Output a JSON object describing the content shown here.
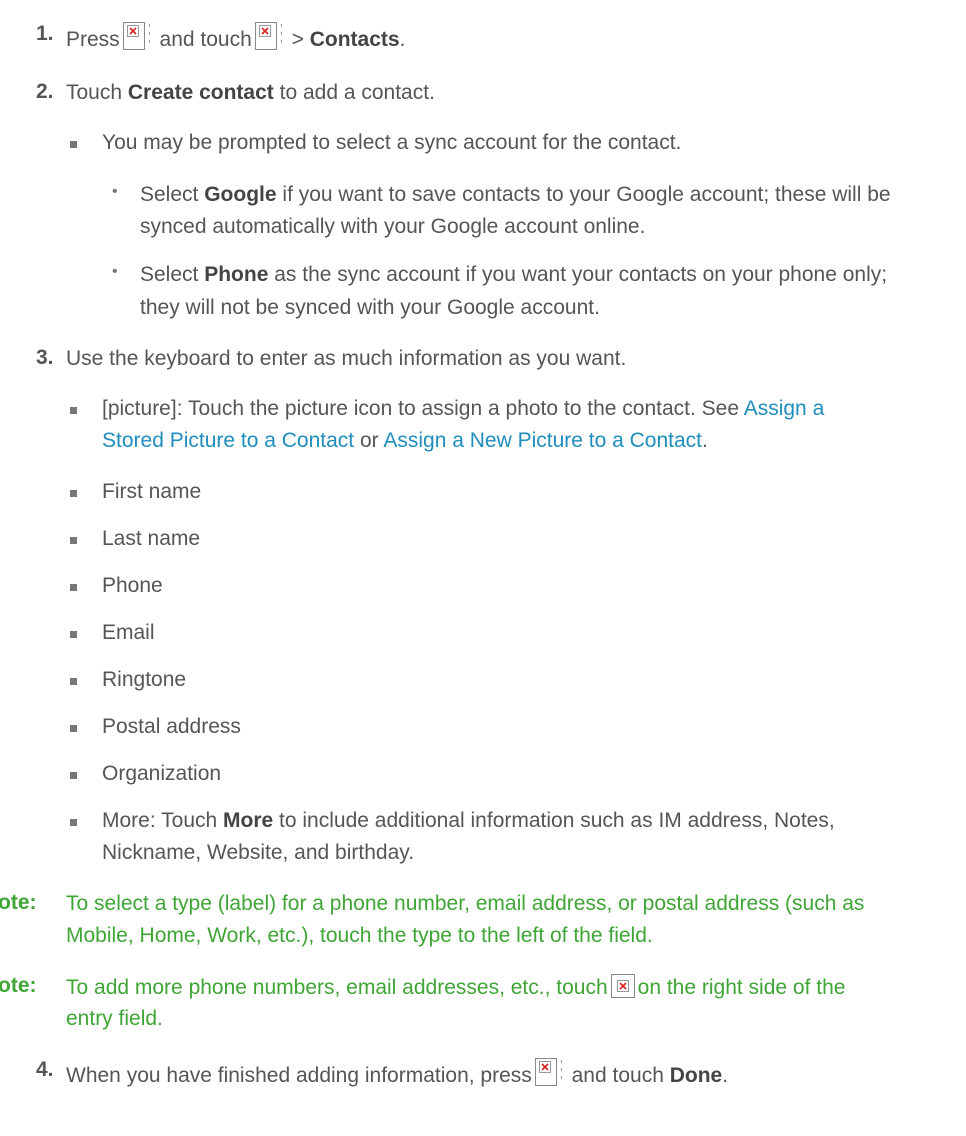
{
  "steps": [
    {
      "num": "1.",
      "press": "Press",
      "and_touch": "and touch",
      "gt": ">",
      "target": "Contacts",
      "end": "."
    },
    {
      "num": "2.",
      "pre": "Touch",
      "target": "Create contact",
      "post": "to add a contact."
    },
    {
      "num": "3.",
      "text": "Use the keyboard to enter as much information as you want."
    },
    {
      "num": "4.",
      "pre": "When you have finished adding information, press",
      "mid": "and touch",
      "target": "Done",
      "end": "."
    }
  ],
  "sync": {
    "prompt": "You may be prompted to select a sync account for the contact.",
    "google": {
      "pre": "Select",
      "bold": "Google",
      "line1": "if you want to save contacts to your Google account; these will be",
      "line2": "synced automatically with your Google account online."
    },
    "phone": {
      "pre": "Select",
      "bold": "Phone",
      "line1": "as the sync account if you want your contacts on your phone only;",
      "line2": "they will not be synced with your Google account."
    }
  },
  "fields": {
    "picture": {
      "pre": "[picture]: Touch the picture icon to assign a photo to the contact. See",
      "link1a": "Assign a",
      "link1b": "Stored Picture to a Contact",
      "or": "or",
      "link2": "Assign a New Picture to a Contact",
      "end": "."
    },
    "items": [
      "First name",
      "Last name",
      "Phone",
      "Email",
      "Ringtone",
      "Postal address",
      "Organization"
    ],
    "more": {
      "pre": "More: Touch",
      "bold": "More",
      "line1": "to include additional information such as IM address, Notes,",
      "line2": "Nickname, Website, and birthday."
    }
  },
  "notes": [
    {
      "label": "ote:",
      "line1": "To select a type (label) for a phone number, email address, or postal address (such as",
      "line2": "Mobile, Home, Work, etc.), touch the type to the left of the field."
    },
    {
      "label": "ote:",
      "line1a": "To add more phone numbers, email addresses, etc., touch",
      "line1b": "on the right side of the",
      "line2": "entry field."
    }
  ],
  "icons": [
    "menu-key-icon",
    "apps-icon",
    "add-field-icon"
  ],
  "colors": {
    "text": "#555555",
    "link": "#1f8dbd",
    "note": "#3fa535"
  }
}
